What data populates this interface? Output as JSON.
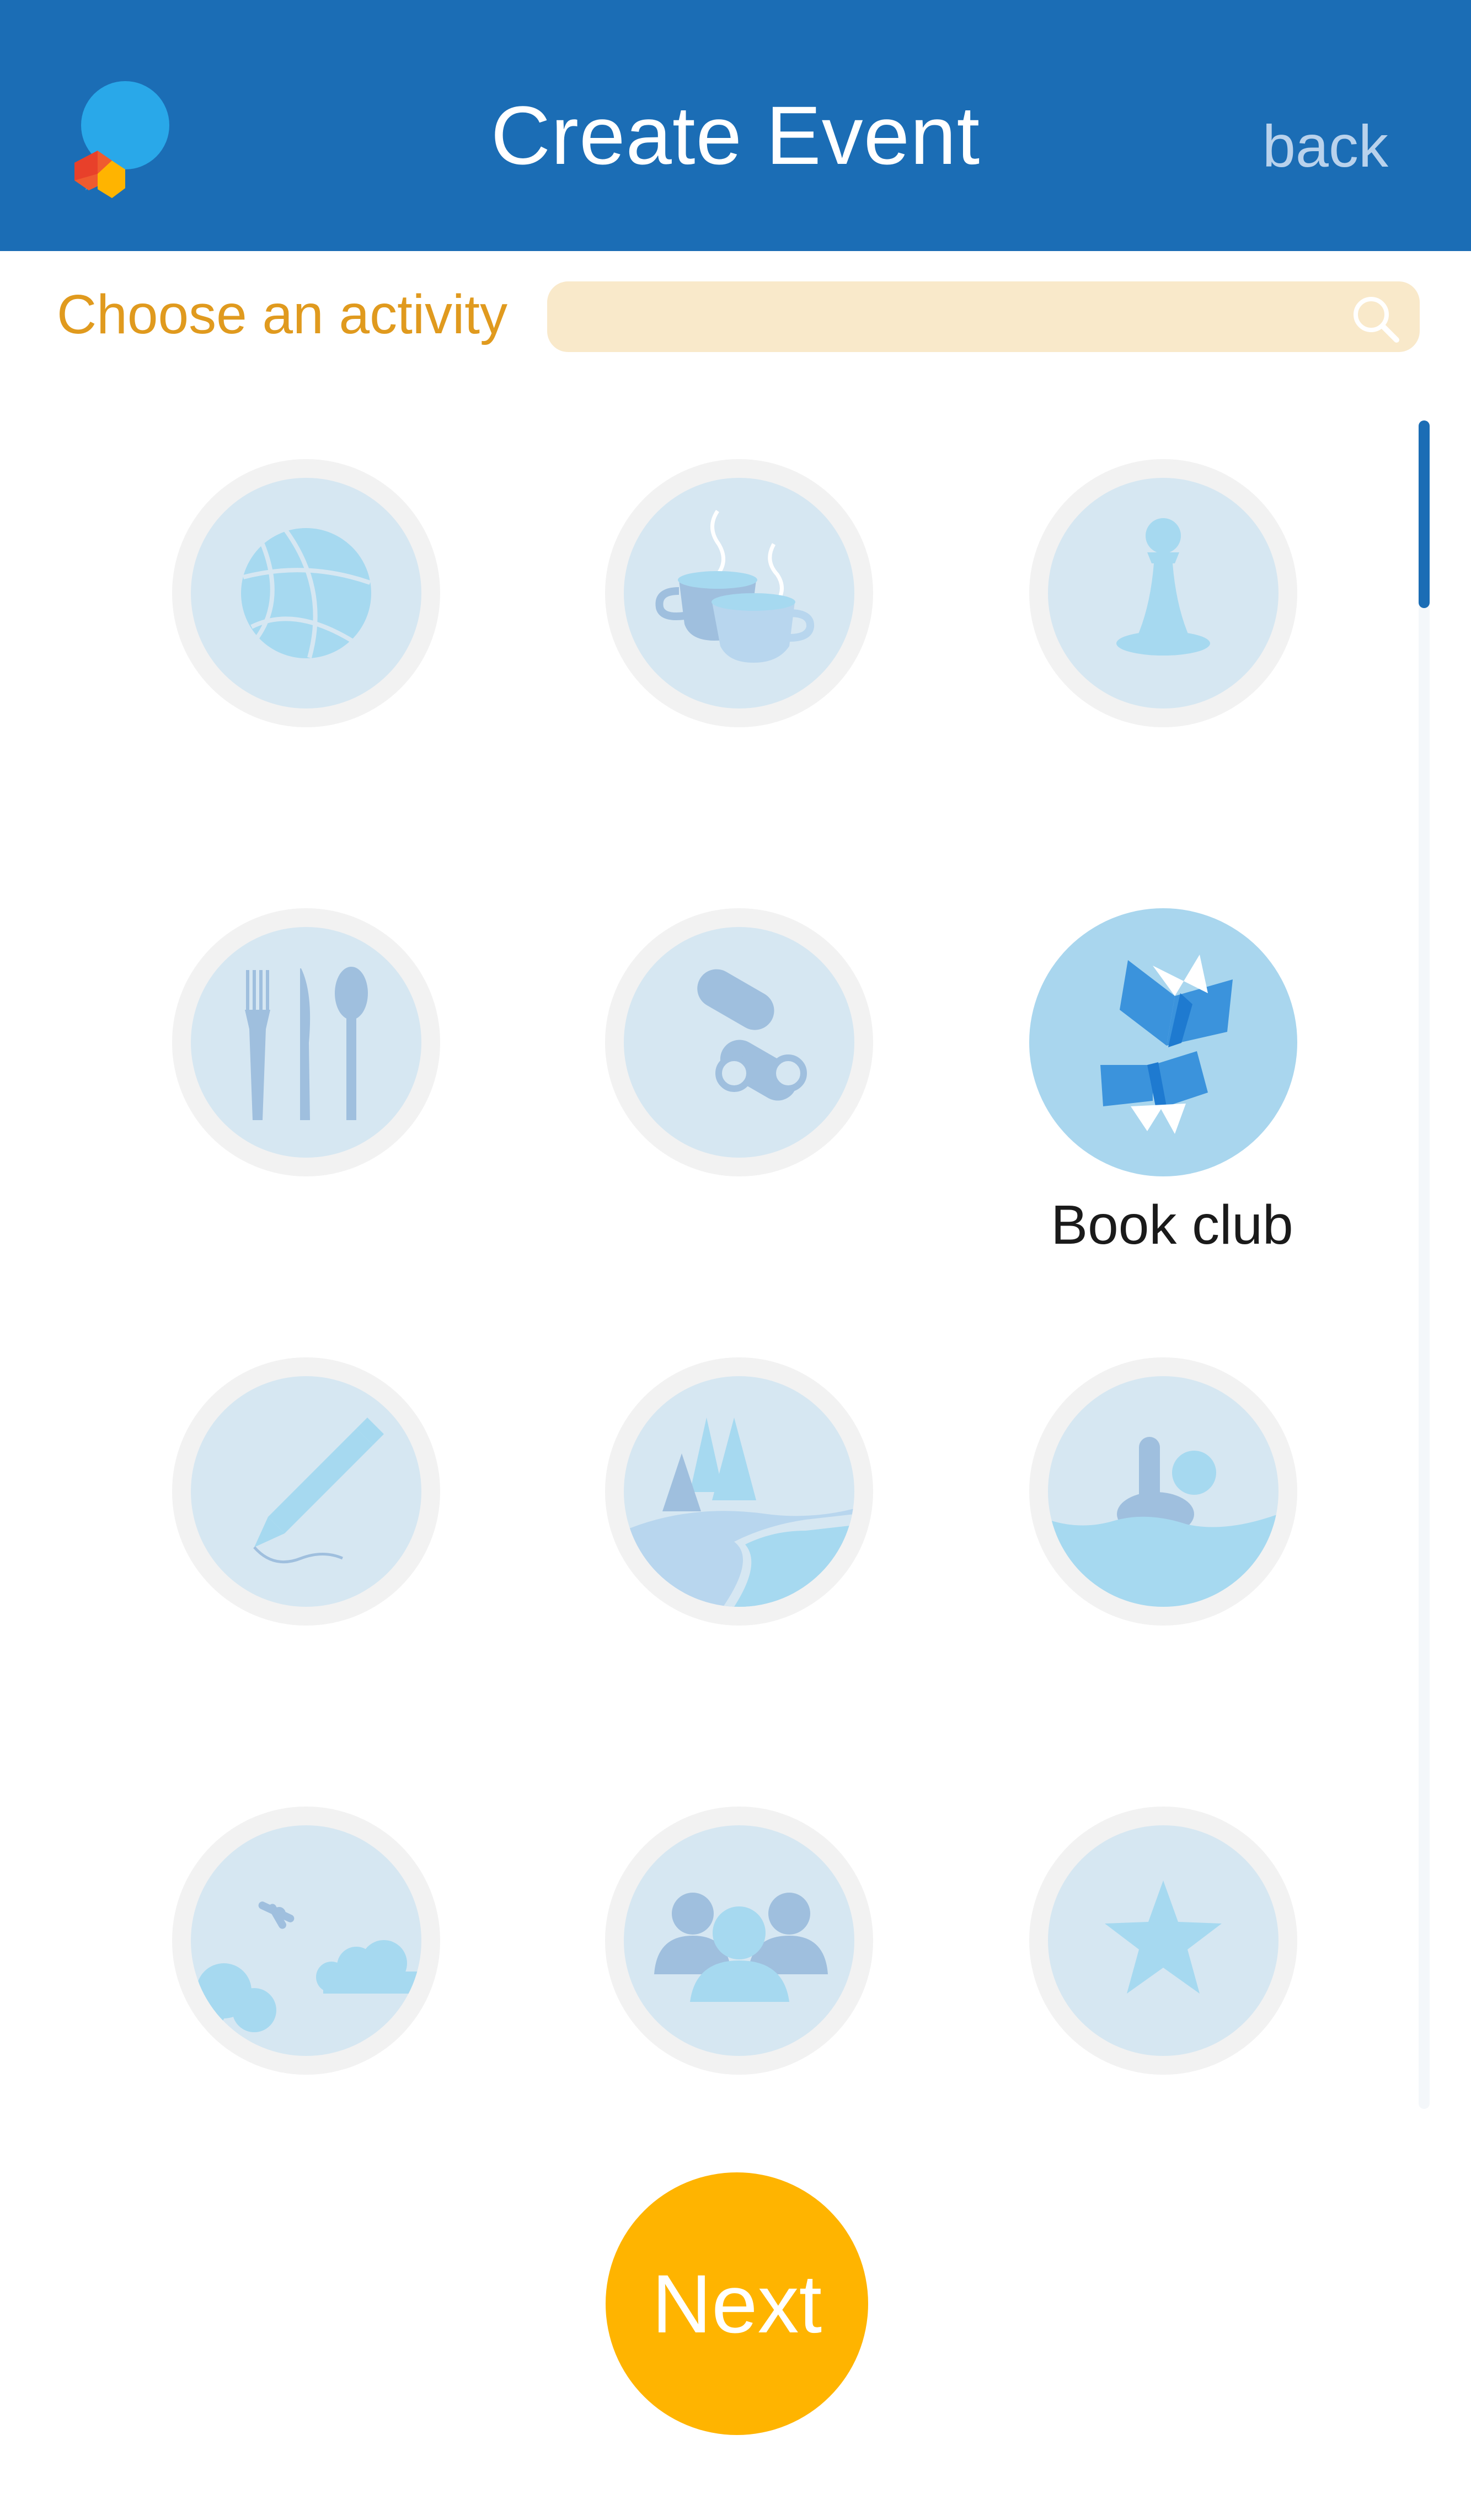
{
  "header": {
    "title": "Create Event",
    "back_label": "back",
    "logo_icon": "app-logo-icon",
    "background_color": "#1b6db5"
  },
  "filter": {
    "label": "Choose an activity",
    "search_value": "",
    "search_placeholder": "",
    "search_icon": "search-icon",
    "search_background": "#f9e9ca"
  },
  "activities": [
    {
      "icon": "basketball-icon",
      "selected": false
    },
    {
      "icon": "coffee-cups-icon",
      "selected": false
    },
    {
      "icon": "chess-pawn-icon",
      "selected": false
    },
    {
      "icon": "cutlery-icon",
      "selected": false
    },
    {
      "icon": "binoculars-icon",
      "selected": false
    },
    {
      "icon": "book-club-icon",
      "selected": true,
      "label": "Book club"
    },
    {
      "icon": "pencil-icon",
      "selected": false
    },
    {
      "icon": "forest-river-icon",
      "selected": false
    },
    {
      "icon": "swimming-icon",
      "selected": false
    },
    {
      "icon": "skydiving-icon",
      "selected": false
    },
    {
      "icon": "people-group-icon",
      "selected": false
    },
    {
      "icon": "star-icon",
      "selected": false
    }
  ],
  "selected_activity_label": "Book club",
  "next_label": "Next",
  "colors": {
    "accent": "#ffb400",
    "label_orange": "#e09a1e",
    "icon_disc": "#d6e7f2",
    "selected_disc": "#a9d6ee"
  }
}
